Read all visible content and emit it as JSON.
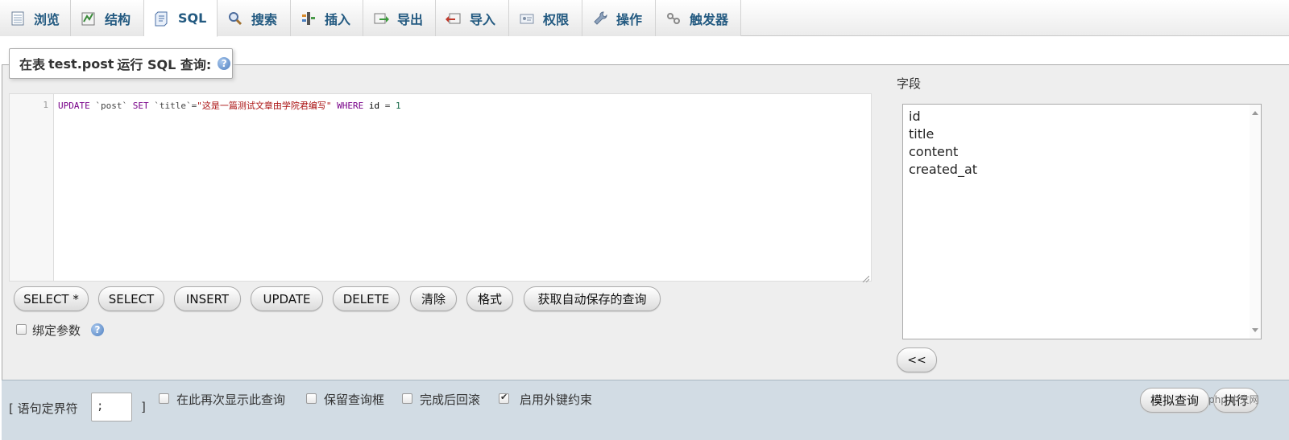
{
  "tabs": [
    {
      "label": "浏览",
      "icon": "browse-icon"
    },
    {
      "label": "结构",
      "icon": "structure-icon"
    },
    {
      "label": "SQL",
      "icon": "sql-icon",
      "active": true
    },
    {
      "label": "搜索",
      "icon": "search-icon"
    },
    {
      "label": "插入",
      "icon": "insert-icon"
    },
    {
      "label": "导出",
      "icon": "export-icon"
    },
    {
      "label": "导入",
      "icon": "import-icon"
    },
    {
      "label": "权限",
      "icon": "privileges-icon"
    },
    {
      "label": "操作",
      "icon": "operations-icon"
    },
    {
      "label": "触发器",
      "icon": "triggers-icon"
    }
  ],
  "legend": {
    "prefix": "在表",
    "table": "test.post",
    "suffix": "运行 SQL 查询:",
    "help": "?"
  },
  "editor": {
    "line_number": "1",
    "tokens": {
      "t1": "UPDATE",
      "t2": " ",
      "t3": "`post`",
      "t4": " ",
      "t5": "SET",
      "t6": " ",
      "t7": "`title`",
      "t8": "=",
      "t9": "\"这是一篇测试文章由学院君编写\"",
      "t10": " ",
      "t11": "WHERE",
      "t12": " id ",
      "t13": "=",
      "t14": " ",
      "t15": "1"
    }
  },
  "query_buttons": [
    "SELECT *",
    "SELECT",
    "INSERT",
    "UPDATE",
    "DELETE",
    "清除",
    "格式",
    "获取自动保存的查询"
  ],
  "bind_params": {
    "label": "绑定参数",
    "checked": false,
    "help": "?"
  },
  "fields": {
    "label": "字段",
    "items": [
      "id",
      "title",
      "content",
      "created_at"
    ],
    "insert_button": "<<"
  },
  "bottom": {
    "delimiter_open": "[ 语句定界符",
    "delimiter_value": ";",
    "delimiter_close": "]",
    "options": [
      {
        "label": "在此再次显示此查询",
        "checked": false
      },
      {
        "label": "保留查询框",
        "checked": false
      },
      {
        "label": "完成后回滚",
        "checked": false
      },
      {
        "label": "启用外键约束",
        "checked": true
      }
    ],
    "simulate_button": "模拟查询",
    "execute_button": "执行",
    "watermark": "php 中文网"
  },
  "colors": {
    "tab_text": "#235a81",
    "panel_bg": "#eeeeee",
    "bottom_bar_bg": "#d2dce4",
    "editor_keyword": "#770088",
    "editor_string": "#aa1111",
    "editor_number": "#116644"
  }
}
